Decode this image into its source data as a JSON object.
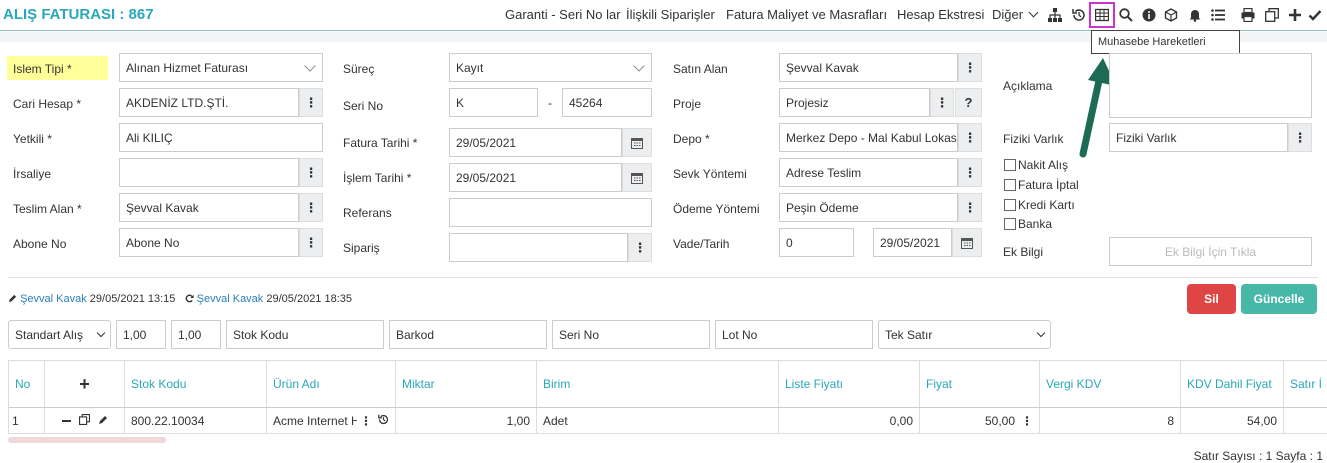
{
  "header": {
    "title": "ALIŞ FATURASI : 867",
    "menu": [
      "Garanti - Seri No lar",
      "İlişkili Siparişler",
      "Fatura Maliyet ve Masrafları",
      "Hesap Ekstresi",
      "Diğer"
    ],
    "icons": [
      "hierarchy-icon",
      "history-icon",
      "table-icon",
      "search-icon",
      "info-icon",
      "cube-icon",
      "bell-icon",
      "list-icon",
      "print-icon",
      "copy-icon",
      "plus-icon",
      "check-icon"
    ],
    "tooltip": "Muhasebe Hareketleri"
  },
  "form": {
    "islem_tipi_label": "Islem Tipi *",
    "islem_tipi_value": "Alınan Hizmet Faturası",
    "cari_hesap_label": "Cari Hesap *",
    "cari_hesap_value": "AKDENİZ LTD.ŞTİ.",
    "yetkili_label": "Yetkili *",
    "yetkili_value": "Ali KILIÇ",
    "irsaliye_label": "İrsaliye",
    "irsaliye_value": "",
    "teslim_alan_label": "Teslim Alan *",
    "teslim_alan_value": "Şevval Kavak",
    "abone_no_label": "Abone No",
    "abone_no_placeholder": "Abone No",
    "surec_label": "Süreç",
    "surec_value": "Kayıt",
    "seri_no_label": "Seri No",
    "seri_no_prefix": "K",
    "seri_no_dash": "-",
    "seri_no_number": "45264",
    "fatura_tarihi_label": "Fatura Tarihi *",
    "fatura_tarihi_value": "29/05/2021",
    "islem_tarihi_label": "İşlem Tarihi *",
    "islem_tarihi_value": "29/05/2021",
    "referans_label": "Referans",
    "referans_value": "",
    "siparis_label": "Sipariş",
    "siparis_value": "",
    "satin_alan_label": "Satın Alan",
    "satin_alan_value": "Şevval Kavak",
    "proje_label": "Proje",
    "proje_value": "Projesiz",
    "depo_label": "Depo *",
    "depo_value": "Merkez Depo - Mal Kabul Lokas",
    "sevk_label": "Sevk Yöntemi",
    "sevk_value": "Adrese Teslim",
    "odeme_label": "Ödeme Yöntemi",
    "odeme_value": "Peşin Ödeme",
    "vade_label": "Vade/Tarih",
    "vade_days": "0",
    "vade_date": "29/05/2021",
    "aciklama_label": "Açıklama",
    "fiziki_varlik_label": "Fiziki Varlık",
    "fiziki_varlik_placeholder": "Fiziki Varlık",
    "checkboxes": [
      "Nakit Alış",
      "Fatura İptal",
      "Kredi Kartı",
      "Banka"
    ],
    "ek_bilgi_label": "Ek Bilgi",
    "ek_bilgi_button": "Ek Bilgi İçin Tıkla"
  },
  "audit": {
    "created_by": "Şevval Kavak",
    "created_at": "29/05/2021 13:15",
    "updated_by": "Şevval Kavak",
    "updated_at": "29/05/2021 18:35"
  },
  "actions": {
    "delete_label": "Sil",
    "update_label": "Güncelle",
    "delete_color": "#e04545",
    "update_color": "#47b8a8"
  },
  "line_entry": {
    "price_type": "Standart Alış",
    "qty1": "1,00",
    "qty2": "1,00",
    "stock_code_placeholder": "Stok Kodu",
    "barcode_placeholder": "Barkod",
    "serial_placeholder": "Seri No",
    "lot_placeholder": "Lot No",
    "row_mode": "Tek Satır"
  },
  "table": {
    "headers": [
      "No",
      "+",
      "Stok Kodu",
      "Ürün Adı",
      "Miktar",
      "Birim",
      "Liste Fiyatı",
      "Fiyat",
      "Vergi KDV",
      "KDV Dahil Fiyat",
      "Satır İ"
    ],
    "rows": [
      {
        "no": "1",
        "stok_kodu": "800.22.10034",
        "urun_adi": "Acme Internet H",
        "miktar": "1,00",
        "birim": "Adet",
        "liste_fiyati": "0,00",
        "fiyat": "50,00",
        "vergi_kdv": "8",
        "kdv_dahil": "54,00"
      }
    ],
    "footer": "Satır Sayısı : 1 Sayfa : 1"
  },
  "accent_color": "#2aa7b8",
  "highlight_color": "#cc33cc",
  "arrow_color": "#1d6b55"
}
